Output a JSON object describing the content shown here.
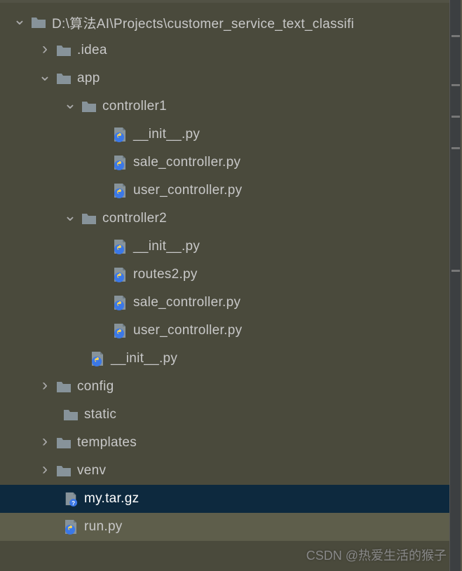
{
  "tree": {
    "root": "D:\\算法AI\\Projects\\customer_service_text_classifi",
    "idea": ".idea",
    "app": "app",
    "controller1": "controller1",
    "c1_init": "__init__.py",
    "c1_sale": "sale_controller.py",
    "c1_user": "user_controller.py",
    "controller2": "controller2",
    "c2_init": "__init__.py",
    "c2_routes": "routes2.py",
    "c2_sale": "sale_controller.py",
    "c2_user": "user_controller.py",
    "app_init": "__init__.py",
    "config": "config",
    "static": "static",
    "templates": "templates",
    "venv": "venv",
    "mytar": "my.tar.gz",
    "runpy": "run.py"
  },
  "watermark": "CSDN @热爱生活的猴子"
}
